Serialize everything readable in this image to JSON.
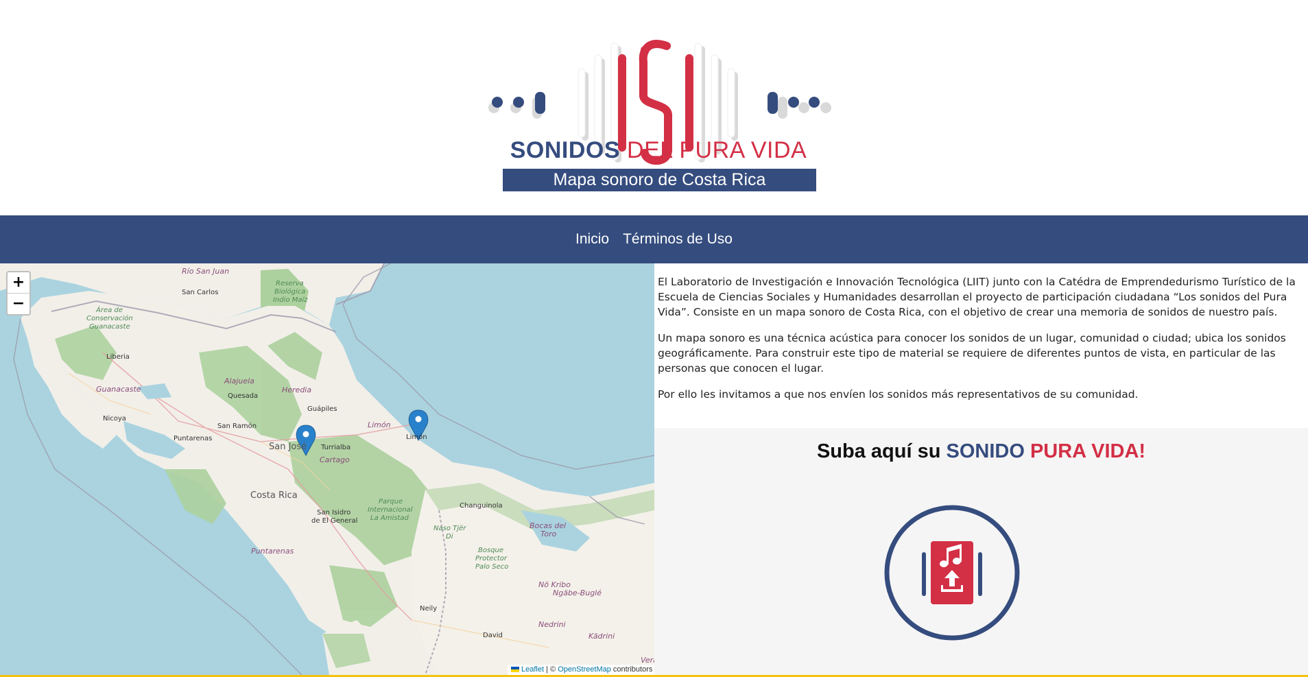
{
  "logo": {
    "brand_part1": "SONIDOS",
    "brand_part2": "DEL PURA VIDA",
    "tagline": "Mapa sonoro de Costa Rica"
  },
  "nav": {
    "items": [
      {
        "label": "Inicio"
      },
      {
        "label": "Términos de Uso"
      }
    ]
  },
  "map": {
    "zoom_in": "+",
    "zoom_out": "−",
    "attribution": {
      "leaflet": "Leaflet",
      "separator": "| ©",
      "osm": "OpenStreetMap",
      "contributors": "contributors"
    },
    "labels": {
      "rio_san_juan": "Río San Juan",
      "san_carlos": "San Carlos",
      "reserva": "Reserva",
      "biologica": "Biológica",
      "indio_maiz": "Indio Maíz",
      "area_de": "Área de",
      "conservacion": "Conservación",
      "guanacaste_acg": "Guanacaste",
      "liberia": "Liberia",
      "alajuela": "Alajuela",
      "heredia": "Heredia",
      "guanacaste": "Guanacaste",
      "quesada": "Quesada",
      "nicoya": "Nicoya",
      "guapiles": "Guápiles",
      "puntarenas_city": "Puntarenas",
      "san_ramon": "San Ramón",
      "limon_prov": "Limón",
      "limon_city": "Limón",
      "san_jose": "San José",
      "turrialba": "Turrialba",
      "cartago": "Cartago",
      "costa_rica": "Costa Rica",
      "changuinola": "Changuinola",
      "parque": "Parque",
      "internacional": "Internacional",
      "la_amistad": "La Amistad",
      "san_isidro": "San Isidro",
      "de_el_general": "de El General",
      "naso_tjer": "Naso Tjër",
      "di": "Di",
      "bocas_del": "Bocas del",
      "toro": "Toro",
      "bosque": "Bosque",
      "protector": "Protector",
      "palo_seco": "Palo Seco",
      "puntarenas_prov": "Puntarenas",
      "no_kribo": "Nö Kribo",
      "ngabe_bugle": "Ngäbe-Buglé",
      "neily": "Neily",
      "nedrini": "Nedrini",
      "david": "David",
      "kadrini": "Kädrini",
      "vera": "Vera"
    }
  },
  "info": {
    "p1": "El Laboratorio de Investigación e Innovación Tecnológica (LIIT) junto con la Catédra de Emprendedurismo Turístico de la Escuela de Ciencias Sociales y Humanidades desarrollan el proyecto de participación ciudadana “Los sonidos del Pura Vida”. Consiste en un mapa sonoro de Costa Rica, con el objetivo de crear una memoria de sonidos de nuestro país.",
    "p2": "Un mapa sonoro es una técnica acústica para conocer los sonidos de un lugar, comunidad o ciudad; ubica los sonidos geográficamente. Para construir este tipo de material se requiere de diferentes puntos de vista, en particular de las personas que conocen el lugar.",
    "p3": "Por ello les invitamos a que nos envíen los sonidos más representativos de su comunidad."
  },
  "upload": {
    "title_prefix": "Suba aquí su",
    "title_word1": "SONIDO",
    "title_word2": "PURA VIDA!"
  },
  "colors": {
    "brand_blue": "#354c7e",
    "brand_red": "#d32f45",
    "sea": "#aad3df",
    "land": "#f2efe9",
    "forest": "#add19e",
    "marker": "#2a81cb",
    "footer_accent": "#f4c20d"
  },
  "icons": {
    "marker": "map-marker-icon",
    "upload": "music-upload-icon"
  }
}
